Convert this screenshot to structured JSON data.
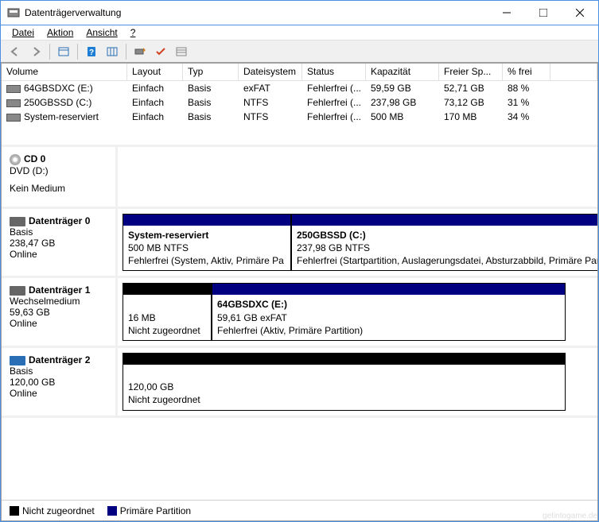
{
  "title": "Datenträgerverwaltung",
  "menu": {
    "file": "Datei",
    "action": "Aktion",
    "view": "Ansicht",
    "help": "?"
  },
  "columns": {
    "volume": "Volume",
    "layout": "Layout",
    "type": "Typ",
    "fs": "Dateisystem",
    "status": "Status",
    "capacity": "Kapazität",
    "free": "Freier Sp...",
    "pct": "% frei"
  },
  "volumes": [
    {
      "name": "64GBSDXC (E:)",
      "layout": "Einfach",
      "type": "Basis",
      "fs": "exFAT",
      "status": "Fehlerfrei (...",
      "capacity": "59,59 GB",
      "free": "52,71 GB",
      "pct": "88 %"
    },
    {
      "name": "250GBSSD (C:)",
      "layout": "Einfach",
      "type": "Basis",
      "fs": "NTFS",
      "status": "Fehlerfrei (...",
      "capacity": "237,98 GB",
      "free": "73,12 GB",
      "pct": "31 %"
    },
    {
      "name": "System-reserviert",
      "layout": "Einfach",
      "type": "Basis",
      "fs": "NTFS",
      "status": "Fehlerfrei (...",
      "capacity": "500 MB",
      "free": "170 MB",
      "pct": "34 %"
    }
  ],
  "disks": {
    "cd0": {
      "name": "CD 0",
      "line2": "DVD (D:)",
      "line3": "Kein Medium"
    },
    "d0": {
      "name": "Datenträger 0",
      "type": "Basis",
      "size": "238,47 GB",
      "status": "Online",
      "parts": [
        {
          "title": "System-reserviert",
          "sub": "500 MB NTFS",
          "desc": "Fehlerfrei (System, Aktiv, Primäre Pa"
        },
        {
          "title": "250GBSSD  (C:)",
          "sub": "237,98 GB NTFS",
          "desc": "Fehlerfrei (Startpartition, Auslagerungsdatei, Absturzabbild, Primäre Partition)"
        }
      ]
    },
    "d1": {
      "name": "Datenträger 1",
      "type": "Wechselmedium",
      "size": "59,63 GB",
      "status": "Online",
      "parts": [
        {
          "sub": "16 MB",
          "desc": "Nicht zugeordnet"
        },
        {
          "title": "64GBSDXC  (E:)",
          "sub": "59,61 GB exFAT",
          "desc": "Fehlerfrei (Aktiv, Primäre Partition)"
        }
      ]
    },
    "d2": {
      "name": "Datenträger 2",
      "type": "Basis",
      "size": "120,00 GB",
      "status": "Online",
      "parts": [
        {
          "sub": "120,00 GB",
          "desc": "Nicht zugeordnet"
        }
      ]
    }
  },
  "legend": {
    "unalloc": "Nicht zugeordnet",
    "primary": "Primäre Partition"
  },
  "watermark": "getintogame.de"
}
